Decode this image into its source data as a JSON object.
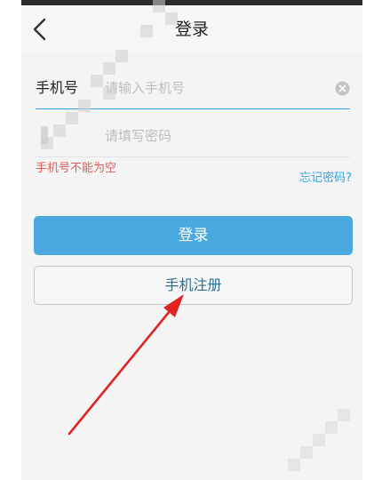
{
  "header": {
    "title": "登录",
    "back_icon": "chevron-left-icon"
  },
  "form": {
    "phone_label": "手机号",
    "phone_placeholder": "请输入手机号",
    "phone_value": "",
    "password_placeholder": "请填写密码",
    "password_value": "",
    "clear_icon": "clear-circle-icon",
    "error_text": "手机号不能为空",
    "forgot_link": "忘记密码?"
  },
  "actions": {
    "login_label": "登录",
    "register_label": "手机注册"
  },
  "colors": {
    "accent": "#4aa9df",
    "link": "#36a3de",
    "error": "#e05a5a",
    "annotation": "#e02424"
  }
}
